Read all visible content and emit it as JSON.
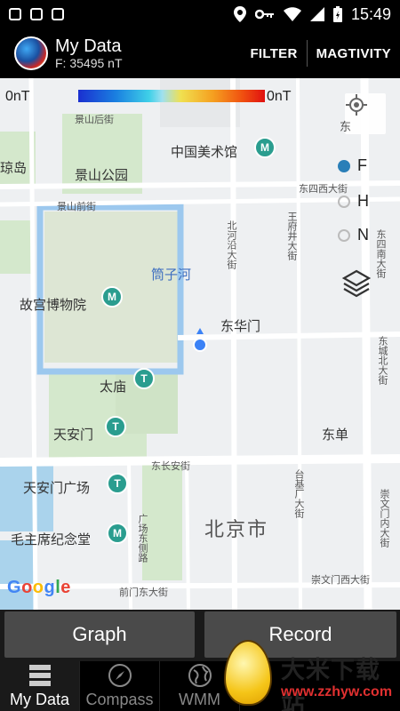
{
  "status_bar": {
    "time": "15:49"
  },
  "app_bar": {
    "title": "My Data",
    "subtitle": "F: 35495 nT",
    "filter_label": "FILTER",
    "magtivity_label": "MAGTIVITY"
  },
  "map": {
    "scale_min": "0nT",
    "scale_max": "0nT",
    "radio_options": [
      "F",
      "H",
      "N"
    ],
    "selected_radio": "F",
    "google_logo": "Google",
    "labels": {
      "jingshan_houjie": "景山后街",
      "china_art_museum": "中国美术馆",
      "dongcheng_cut": "东",
      "jingdao": "琼岛",
      "jingshan_park": "景山公园",
      "dongsi_xidajie": "东四西大街",
      "jingshan_qianjie": "景山前街",
      "beiheyan": "北河沿大街",
      "wangfujing": "王府井大街",
      "dongsi_nan": "东四南大街",
      "tongzihe": "筒子河",
      "palace_museum": "故宫博物院",
      "donghuamen": "东华门",
      "dongcheng_beida": "东城北大街",
      "taimiao": "太庙",
      "tiananmen": "天安门",
      "dongdan": "东单",
      "dongchangan": "东长安街",
      "tiananmen_square": "天安门广场",
      "beijing": "北京市",
      "taijichang": "台基厂大街",
      "mausoleum": "毛主席纪念堂",
      "guangchang_dong": "广场东侧路",
      "chongwenmen_nei": "崇文门内大街",
      "qianmen_dongdajie": "前门东大街",
      "chongwenmen_xidajie": "崇文门西大街"
    }
  },
  "buttons": {
    "graph": "Graph",
    "record": "Record"
  },
  "bottom_nav": [
    {
      "label": "My Data",
      "icon": "database-icon",
      "active": true
    },
    {
      "label": "Compass",
      "icon": "compass-icon",
      "active": false
    },
    {
      "label": "WMM",
      "icon": "globe-icon",
      "active": false
    }
  ],
  "watermark": {
    "title": "大米下载站",
    "url": "www.zzhyw.com"
  }
}
